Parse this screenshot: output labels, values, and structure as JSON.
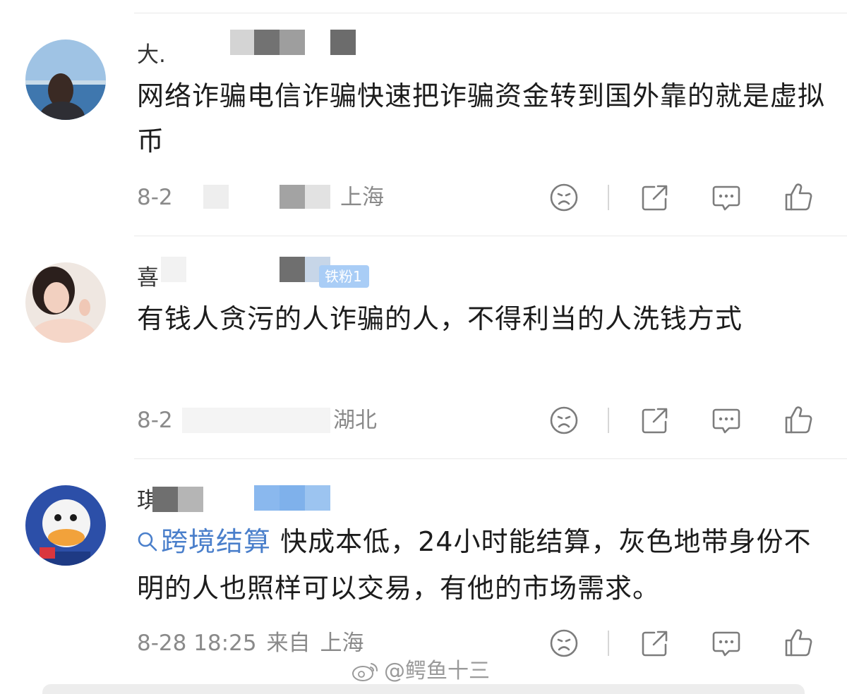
{
  "comments": [
    {
      "username_visible": "大.",
      "text": "网络诈骗电信诈骗快速把诈骗资金转到国外靠的就是虚拟币",
      "date_partial": "8-2",
      "location": "上海"
    },
    {
      "username_visible": "喜",
      "badge": "铁粉1",
      "text": "有钱人贪污的人诈骗的人，不得利当的人洗钱方式",
      "date_partial": "8-2",
      "location": "湖北"
    },
    {
      "username_visible": "琪",
      "topic": "跨境结算",
      "text": "快成本低，24小时能结算，灰色地带身份不明的人也照样可以交易，有他的市场需求。",
      "date": "8-28 18:25",
      "from": "来自",
      "location": "上海"
    }
  ],
  "actions": [
    "dislike-icon",
    "share-icon",
    "comment-icon",
    "like-icon"
  ],
  "watermark": "@鳄鱼十三",
  "colors": {
    "topic": "#4a7fcb",
    "meta": "#8a8a8a",
    "badge": "#a9cdf6"
  }
}
